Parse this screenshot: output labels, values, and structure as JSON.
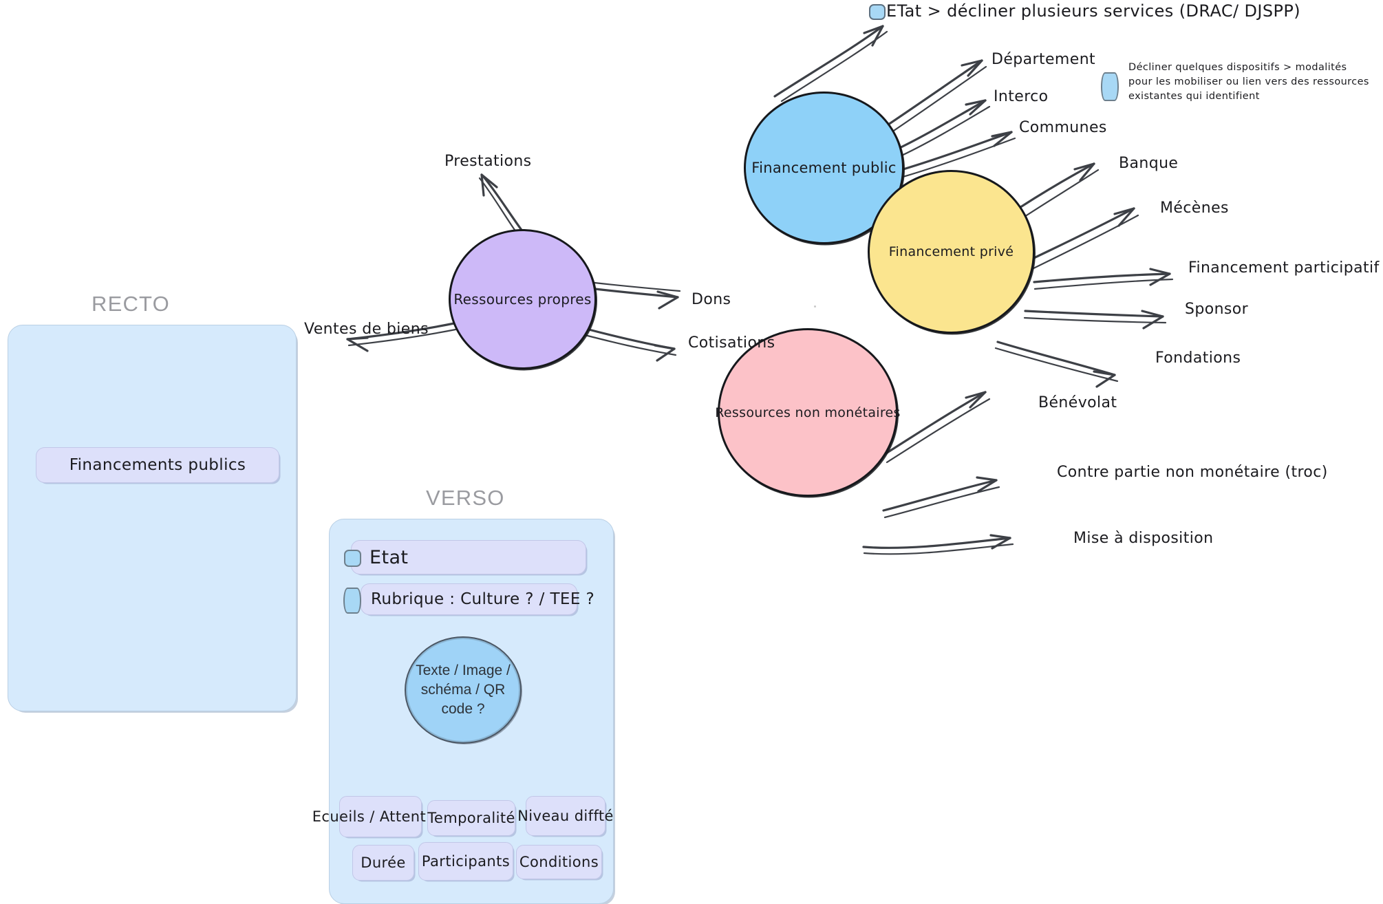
{
  "diagram": {
    "title_note": {
      "icon": "diamond-icon",
      "text": "Décliner quelques dispositifs > modalités pour les mobiliser ou lien vers des ressources existantes qui identifient"
    },
    "top_callout": {
      "icon": "hexagon-icon",
      "text": "ETat > décliner plusieurs services (DRAC/ DJSPP)"
    },
    "nodes": [
      {
        "id": "financement-public",
        "label": "Financement public",
        "color": "#8ed1f8",
        "leaves": [
          "ETat > décliner plusieurs services (DRAC/ DJSPP)",
          "Département",
          "Interco",
          "Communes"
        ]
      },
      {
        "id": "financement-prive",
        "label": "Financement privé",
        "color": "#fbe58f",
        "leaves": [
          "Banque",
          "Mécènes",
          "Financement participatif",
          "Sponsor",
          "Fondations"
        ]
      },
      {
        "id": "ressources-non-monetaires",
        "label": "Ressources non monétaires",
        "color": "#fcc2c8",
        "leaves": [
          "Bénévolat",
          "Contre partie non monétaire (troc)",
          "Mise à disposition"
        ]
      },
      {
        "id": "ressources-propres",
        "label": "Ressources propres",
        "color": "#cdb9f8",
        "leaves": [
          "Prestations",
          "Dons",
          "Cotisations",
          "Ventes de biens"
        ]
      }
    ],
    "leaf_labels": {
      "departement": "Département",
      "interco": "Interco",
      "communes": "Communes",
      "banque": "Banque",
      "mecenes": "Mécènes",
      "financement_participatif": "Financement participatif",
      "sponsor": "Sponsor",
      "fondations": "Fondations",
      "benevolat": "Bénévolat",
      "contre_partie": "Contre partie non monétaire (troc)",
      "mise_a_disposition": "Mise à disposition",
      "prestations": "Prestations",
      "dons": "Dons",
      "cotisations": "Cotisations",
      "ventes_de_biens": "Ventes de biens"
    }
  },
  "cards": {
    "recto": {
      "title": "RECTO",
      "field_label": "Financements publics"
    },
    "verso": {
      "title": "VERSO",
      "fields": [
        {
          "icon": "hexagon-icon",
          "label": "Etat"
        },
        {
          "icon": "diamond-icon",
          "label": "Rubrique : Culture ? / TEE ?"
        }
      ],
      "media_circle": "Texte / Image / schéma / QR code ?",
      "chips_row1": [
        "Ecueils / Attention",
        "Temporalité",
        "Niveau diffté"
      ],
      "chips_row2": [
        "Durée",
        "Participants",
        "Conditions"
      ]
    }
  },
  "colors": {
    "blue": "#8ed1f8",
    "yellow": "#fbe58f",
    "pink": "#fcc2c8",
    "purple": "#cdb9f8",
    "card_bg": "#d6eafc",
    "field_bg": "#dde0fa",
    "stroke": "#16181c",
    "muted_title": "#9a9ba0"
  }
}
